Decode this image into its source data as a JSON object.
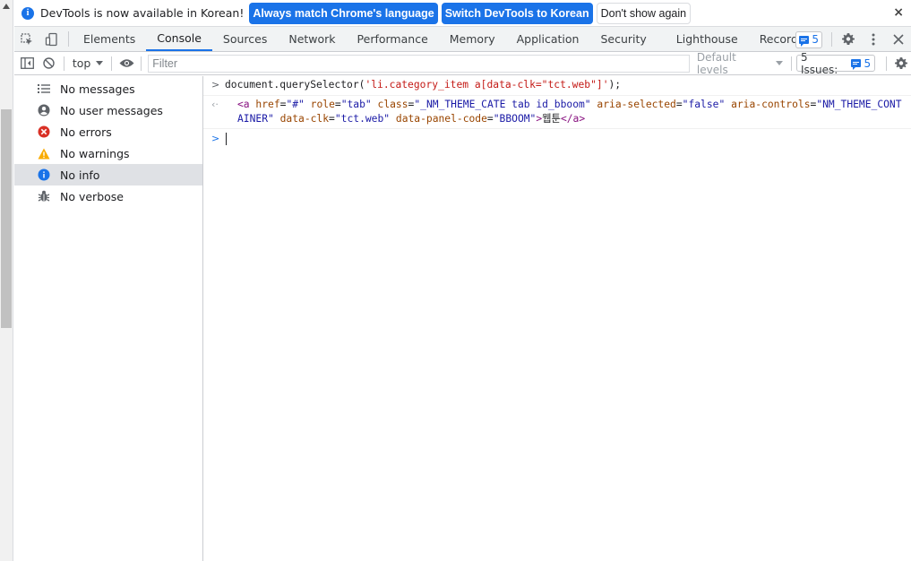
{
  "infobar": {
    "message": "DevTools is now available in Korean!",
    "match_button": "Always match Chrome's language",
    "switch_button": "Switch DevTools to Korean",
    "dismiss_button": "Don't show again",
    "close": "×"
  },
  "tabs": [
    {
      "label": "Elements"
    },
    {
      "label": "Console",
      "active": true
    },
    {
      "label": "Sources"
    },
    {
      "label": "Network"
    },
    {
      "label": "Performance"
    },
    {
      "label": "Memory"
    },
    {
      "label": "Application"
    },
    {
      "label": "Security"
    },
    {
      "label": "Lighthouse"
    },
    {
      "label": "Recorder"
    }
  ],
  "tabbar": {
    "messages_count": "5"
  },
  "toolbar": {
    "context": "top",
    "filter_placeholder": "Filter",
    "levels": "Default levels",
    "issues_label": "5 Issues:",
    "issues_count": "5"
  },
  "sidebar": {
    "items": [
      {
        "label": "No messages",
        "icon": "list-icon"
      },
      {
        "label": "No user messages",
        "icon": "user-icon"
      },
      {
        "label": "No errors",
        "icon": "error-icon"
      },
      {
        "label": "No warnings",
        "icon": "warning-icon"
      },
      {
        "label": "No info",
        "icon": "info-icon",
        "selected": true
      },
      {
        "label": "No verbose",
        "icon": "bug-icon"
      }
    ]
  },
  "console": {
    "input": {
      "prefix": "document.querySelector(",
      "string": "'li.category_item a[data-clk=\"tct.web\"]'",
      "suffix": ");"
    },
    "output": {
      "open_tag": "<a",
      "attrs": [
        {
          "name": "href",
          "value": "\"#\""
        },
        {
          "name": "role",
          "value": "\"tab\""
        },
        {
          "name": "class",
          "value": "\"_NM_THEME_CATE tab id_bboom\""
        },
        {
          "name": "aria-selected",
          "value": "\"false\""
        },
        {
          "name": "aria-controls",
          "value": "\"NM_THEME_CONTAINER\""
        },
        {
          "name": "data-clk",
          "value": "\"tct.web\""
        },
        {
          "name": "data-panel-code",
          "value": "\"BBOOM\""
        }
      ],
      "close_bracket": ">",
      "text": "웹툰",
      "close_tag": "</a>"
    }
  },
  "colors": {
    "accent": "#1a73e8",
    "error": "#d93025",
    "warning": "#f9ab00"
  }
}
